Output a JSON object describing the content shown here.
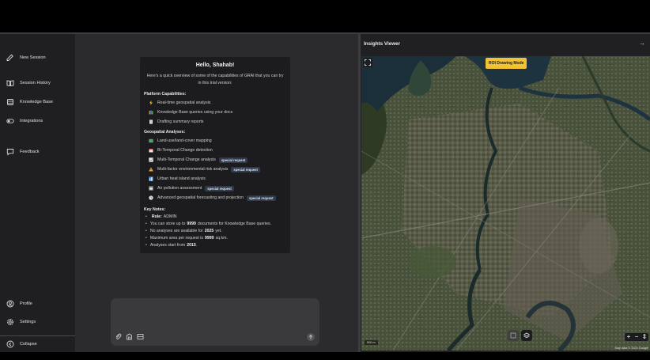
{
  "sidebar": {
    "items": [
      {
        "label": "New Session",
        "icon": "edit-icon"
      },
      {
        "label": "Session History",
        "icon": "book-icon"
      },
      {
        "label": "Knowledge Base",
        "icon": "database-icon"
      },
      {
        "label": "Integrations",
        "icon": "toggle-icon"
      },
      {
        "label": "Feedback",
        "icon": "message-icon"
      }
    ],
    "bottom": [
      {
        "label": "Profile",
        "icon": "user-icon"
      },
      {
        "label": "Settings",
        "icon": "gear-icon"
      },
      {
        "label": "Collapse",
        "icon": "arrow-left-icon"
      }
    ]
  },
  "welcome": {
    "title": "Hello, Shahab!",
    "intro": "Here's a quick overview of some of the capabilities of GRAI that you can try in this trial version:",
    "platform_heading": "Platform Capabilities:",
    "platform": [
      {
        "label": "Real-time geospatial analysis",
        "icon": "bolt-icon"
      },
      {
        "label": "Knowledge Base queries using your docs",
        "icon": "books-icon"
      },
      {
        "label": "Drafting summary reports",
        "icon": "document-icon"
      }
    ],
    "geo_heading": "Geospatial Analyses:",
    "geo": [
      {
        "label": "Land-use/land-cover mapping",
        "icon": "map-icon",
        "badge": ""
      },
      {
        "label": "Bi-Temporal Change detection",
        "icon": "calendar-icon",
        "badge": ""
      },
      {
        "label": "Multi-Temporal Change analysis",
        "icon": "chart-icon",
        "badge": "special request"
      },
      {
        "label": "Multi-factor environmental risk analysis",
        "icon": "warning-icon",
        "badge": "special request"
      },
      {
        "label": "Urban heat island analysis",
        "icon": "city-icon",
        "badge": ""
      },
      {
        "label": "Air pollution assessment",
        "icon": "cloud-icon",
        "badge": "special request"
      },
      {
        "label": "Advanced geospatial forecasting and projection",
        "icon": "forecast-icon",
        "badge": "special request"
      }
    ],
    "notes_heading": "Key Notes:",
    "notes": {
      "role_label": "Role:",
      "role_value": "ADMIN",
      "docs_pre": "You can store up to",
      "docs_num": "9999",
      "docs_post": "documents for Knowledge Base queries.",
      "analyses_pre": "No analyses are available for",
      "analyses_year": "2025",
      "analyses_post": "yet.",
      "area_pre": "Maximum area per request is",
      "area_num": "9999",
      "area_post": "sq.km.",
      "start_pre": "Analyses start from",
      "start_year": "2015",
      "start_post": "."
    }
  },
  "composer": {
    "icons": [
      "paperclip-icon",
      "building-icon",
      "table-icon",
      "send-arrow-icon"
    ]
  },
  "viewer": {
    "title": "Insights Viewer",
    "collapse_glyph": "→",
    "roi_label": "ROI Drawing Mode",
    "scale_label": "500 m",
    "attribution": "Map data © 2024 Google",
    "zoom_in": "+",
    "zoom_out": "−",
    "compass": "⇕"
  }
}
